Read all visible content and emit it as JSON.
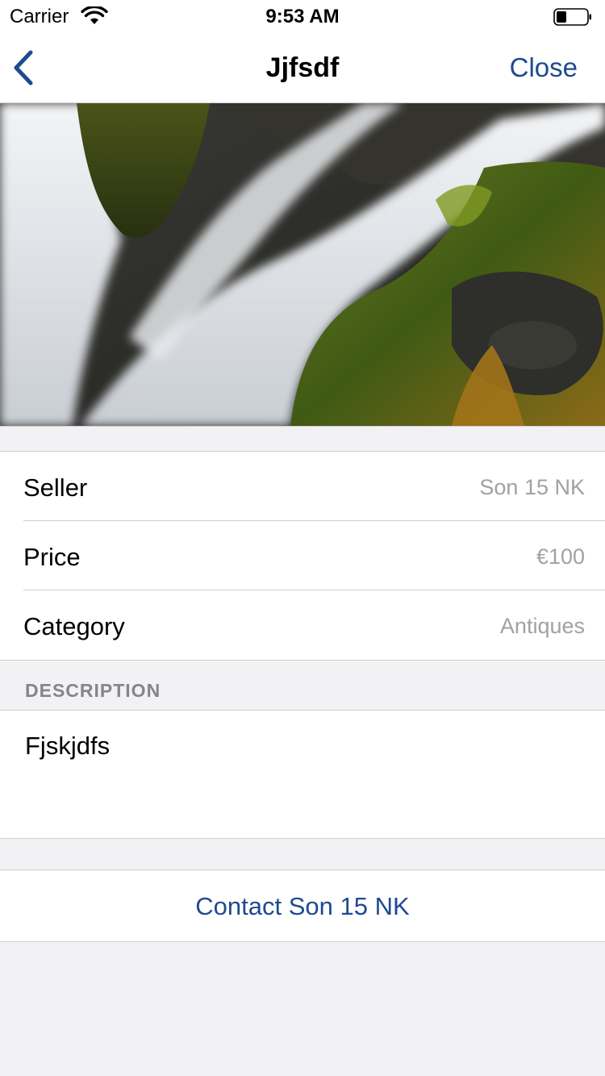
{
  "status_bar": {
    "carrier": "Carrier",
    "time": "9:53 AM",
    "icons": [
      "wifi-icon",
      "battery-icon"
    ]
  },
  "nav": {
    "title": "Jjfsdf",
    "close_label": "Close",
    "back_icon": "chevron-left-icon",
    "accent_color": "#1f4a8f"
  },
  "hero_image": {
    "subject": "waterfall over mossy rocks"
  },
  "details": [
    {
      "label": "Seller",
      "value": "Son 15 NK"
    },
    {
      "label": "Price",
      "value": "€100"
    },
    {
      "label": "Category",
      "value": "Antiques"
    }
  ],
  "description": {
    "header": "DESCRIPTION",
    "text": "Fjskjdfs"
  },
  "contact": {
    "label": "Contact Son 15 NK"
  }
}
